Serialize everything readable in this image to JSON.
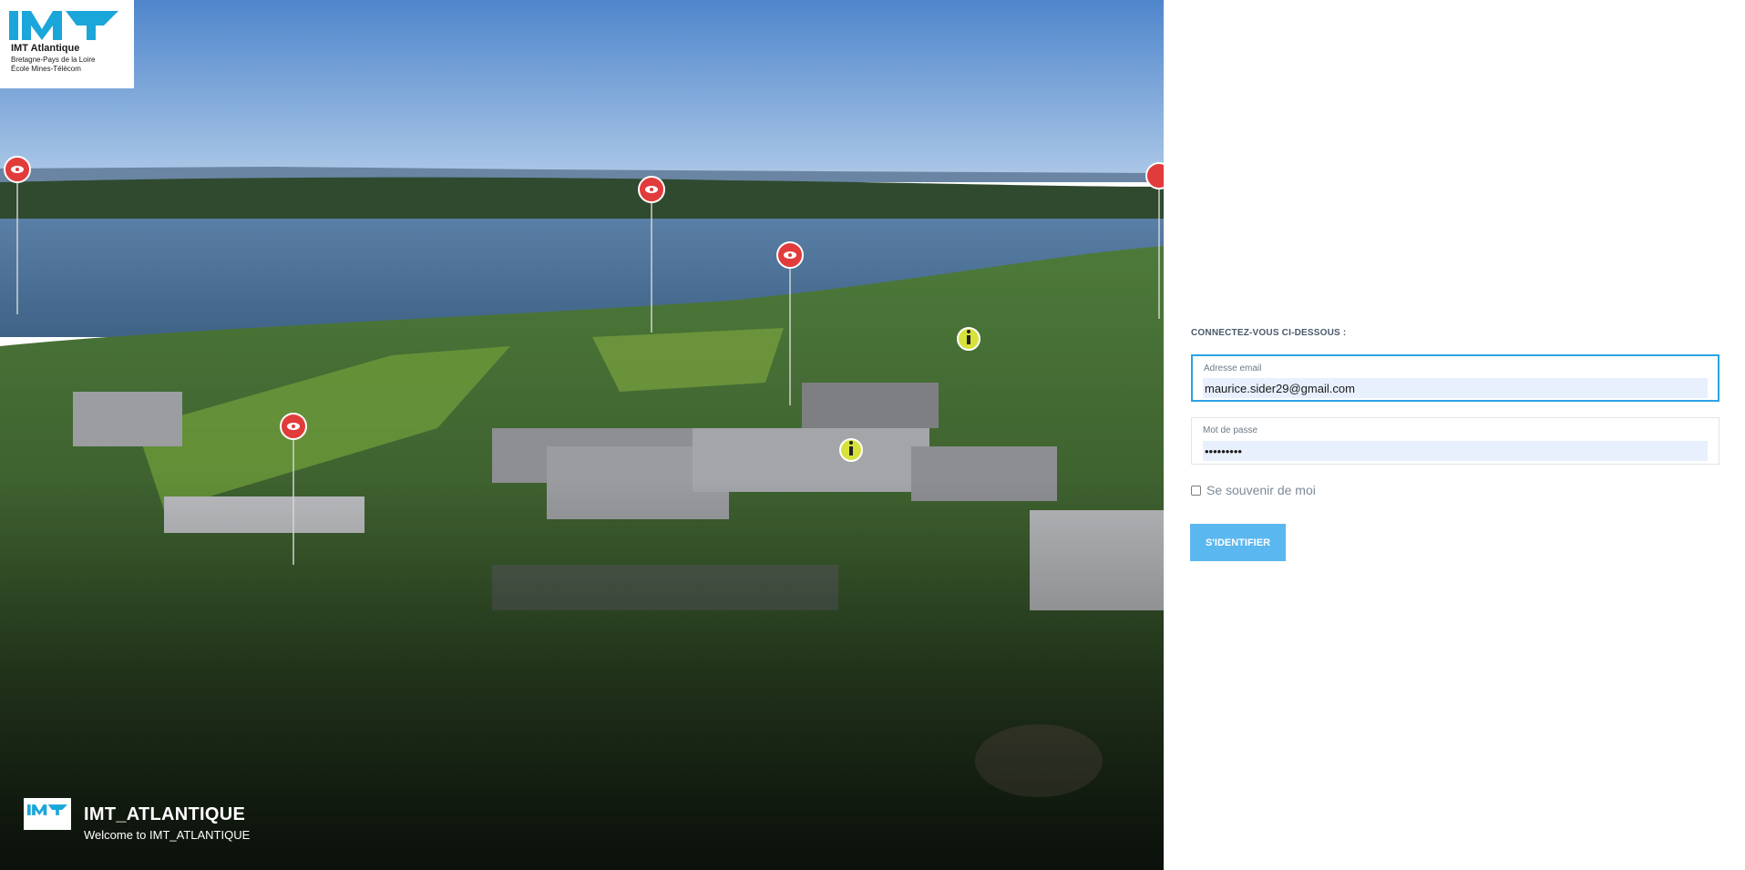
{
  "hero": {
    "logo": {
      "line1": "IMT Atlantique",
      "line2": "Bretagne-Pays de la Loire",
      "line3": "École Mines-Télécom",
      "brand_color": "#1aa6d9"
    },
    "brand_name": "IMT_ATLANTIQUE",
    "brand_tagline": "Welcome to IMT_ATLANTIQUE",
    "hotspot_icons": [
      "eye-pin-icon",
      "eye-pin-icon",
      "eye-pin-icon",
      "eye-pin-icon",
      "eye-pin-icon",
      "info-icon",
      "info-icon"
    ]
  },
  "login": {
    "heading": "CONNECTEZ-VOUS CI-DESSOUS :",
    "email_label": "Adresse email",
    "email_value": "maurice.sider29@gmail.com",
    "password_label": "Mot de passe",
    "password_value": "•••••••••",
    "remember_label": "Se souvenir de moi",
    "remember_checked": false,
    "submit_label": "S'IDENTIFIER",
    "accent_color": "#2aa3e6",
    "button_color": "#5bb7ef"
  }
}
